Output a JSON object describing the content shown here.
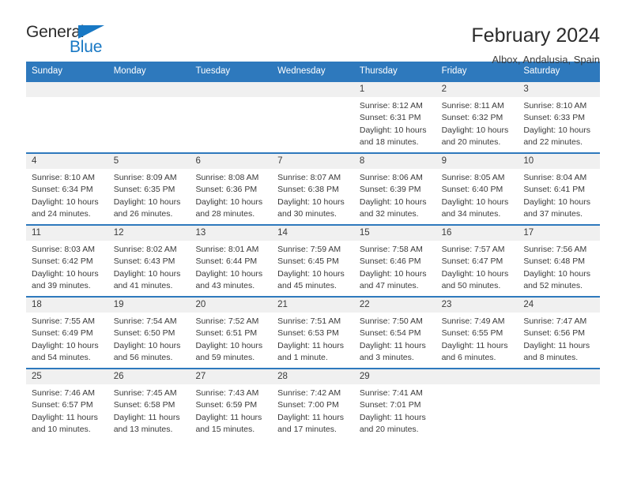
{
  "brand": {
    "name_part1": "General",
    "name_part2": "Blue"
  },
  "header": {
    "title": "February 2024",
    "location": "Albox, Andalusia, Spain"
  },
  "colors": {
    "header_blue": "#2e79bd",
    "daynum_band": "#f0f0f0",
    "brand_blue": "#1878c4",
    "text": "#3a3a3a"
  },
  "calendar": {
    "weekday_headers": [
      "Sunday",
      "Monday",
      "Tuesday",
      "Wednesday",
      "Thursday",
      "Friday",
      "Saturday"
    ],
    "weeks": [
      [
        {
          "day": "",
          "empty": true
        },
        {
          "day": "",
          "empty": true
        },
        {
          "day": "",
          "empty": true
        },
        {
          "day": "",
          "empty": true
        },
        {
          "day": "1",
          "sunrise": "Sunrise: 8:12 AM",
          "sunset": "Sunset: 6:31 PM",
          "daylight_line1": "Daylight: 10 hours",
          "daylight_line2": "and 18 minutes."
        },
        {
          "day": "2",
          "sunrise": "Sunrise: 8:11 AM",
          "sunset": "Sunset: 6:32 PM",
          "daylight_line1": "Daylight: 10 hours",
          "daylight_line2": "and 20 minutes."
        },
        {
          "day": "3",
          "sunrise": "Sunrise: 8:10 AM",
          "sunset": "Sunset: 6:33 PM",
          "daylight_line1": "Daylight: 10 hours",
          "daylight_line2": "and 22 minutes."
        }
      ],
      [
        {
          "day": "4",
          "sunrise": "Sunrise: 8:10 AM",
          "sunset": "Sunset: 6:34 PM",
          "daylight_line1": "Daylight: 10 hours",
          "daylight_line2": "and 24 minutes."
        },
        {
          "day": "5",
          "sunrise": "Sunrise: 8:09 AM",
          "sunset": "Sunset: 6:35 PM",
          "daylight_line1": "Daylight: 10 hours",
          "daylight_line2": "and 26 minutes."
        },
        {
          "day": "6",
          "sunrise": "Sunrise: 8:08 AM",
          "sunset": "Sunset: 6:36 PM",
          "daylight_line1": "Daylight: 10 hours",
          "daylight_line2": "and 28 minutes."
        },
        {
          "day": "7",
          "sunrise": "Sunrise: 8:07 AM",
          "sunset": "Sunset: 6:38 PM",
          "daylight_line1": "Daylight: 10 hours",
          "daylight_line2": "and 30 minutes."
        },
        {
          "day": "8",
          "sunrise": "Sunrise: 8:06 AM",
          "sunset": "Sunset: 6:39 PM",
          "daylight_line1": "Daylight: 10 hours",
          "daylight_line2": "and 32 minutes."
        },
        {
          "day": "9",
          "sunrise": "Sunrise: 8:05 AM",
          "sunset": "Sunset: 6:40 PM",
          "daylight_line1": "Daylight: 10 hours",
          "daylight_line2": "and 34 minutes."
        },
        {
          "day": "10",
          "sunrise": "Sunrise: 8:04 AM",
          "sunset": "Sunset: 6:41 PM",
          "daylight_line1": "Daylight: 10 hours",
          "daylight_line2": "and 37 minutes."
        }
      ],
      [
        {
          "day": "11",
          "sunrise": "Sunrise: 8:03 AM",
          "sunset": "Sunset: 6:42 PM",
          "daylight_line1": "Daylight: 10 hours",
          "daylight_line2": "and 39 minutes."
        },
        {
          "day": "12",
          "sunrise": "Sunrise: 8:02 AM",
          "sunset": "Sunset: 6:43 PM",
          "daylight_line1": "Daylight: 10 hours",
          "daylight_line2": "and 41 minutes."
        },
        {
          "day": "13",
          "sunrise": "Sunrise: 8:01 AM",
          "sunset": "Sunset: 6:44 PM",
          "daylight_line1": "Daylight: 10 hours",
          "daylight_line2": "and 43 minutes."
        },
        {
          "day": "14",
          "sunrise": "Sunrise: 7:59 AM",
          "sunset": "Sunset: 6:45 PM",
          "daylight_line1": "Daylight: 10 hours",
          "daylight_line2": "and 45 minutes."
        },
        {
          "day": "15",
          "sunrise": "Sunrise: 7:58 AM",
          "sunset": "Sunset: 6:46 PM",
          "daylight_line1": "Daylight: 10 hours",
          "daylight_line2": "and 47 minutes."
        },
        {
          "day": "16",
          "sunrise": "Sunrise: 7:57 AM",
          "sunset": "Sunset: 6:47 PM",
          "daylight_line1": "Daylight: 10 hours",
          "daylight_line2": "and 50 minutes."
        },
        {
          "day": "17",
          "sunrise": "Sunrise: 7:56 AM",
          "sunset": "Sunset: 6:48 PM",
          "daylight_line1": "Daylight: 10 hours",
          "daylight_line2": "and 52 minutes."
        }
      ],
      [
        {
          "day": "18",
          "sunrise": "Sunrise: 7:55 AM",
          "sunset": "Sunset: 6:49 PM",
          "daylight_line1": "Daylight: 10 hours",
          "daylight_line2": "and 54 minutes."
        },
        {
          "day": "19",
          "sunrise": "Sunrise: 7:54 AM",
          "sunset": "Sunset: 6:50 PM",
          "daylight_line1": "Daylight: 10 hours",
          "daylight_line2": "and 56 minutes."
        },
        {
          "day": "20",
          "sunrise": "Sunrise: 7:52 AM",
          "sunset": "Sunset: 6:51 PM",
          "daylight_line1": "Daylight: 10 hours",
          "daylight_line2": "and 59 minutes."
        },
        {
          "day": "21",
          "sunrise": "Sunrise: 7:51 AM",
          "sunset": "Sunset: 6:53 PM",
          "daylight_line1": "Daylight: 11 hours",
          "daylight_line2": "and 1 minute."
        },
        {
          "day": "22",
          "sunrise": "Sunrise: 7:50 AM",
          "sunset": "Sunset: 6:54 PM",
          "daylight_line1": "Daylight: 11 hours",
          "daylight_line2": "and 3 minutes."
        },
        {
          "day": "23",
          "sunrise": "Sunrise: 7:49 AM",
          "sunset": "Sunset: 6:55 PM",
          "daylight_line1": "Daylight: 11 hours",
          "daylight_line2": "and 6 minutes."
        },
        {
          "day": "24",
          "sunrise": "Sunrise: 7:47 AM",
          "sunset": "Sunset: 6:56 PM",
          "daylight_line1": "Daylight: 11 hours",
          "daylight_line2": "and 8 minutes."
        }
      ],
      [
        {
          "day": "25",
          "sunrise": "Sunrise: 7:46 AM",
          "sunset": "Sunset: 6:57 PM",
          "daylight_line1": "Daylight: 11 hours",
          "daylight_line2": "and 10 minutes."
        },
        {
          "day": "26",
          "sunrise": "Sunrise: 7:45 AM",
          "sunset": "Sunset: 6:58 PM",
          "daylight_line1": "Daylight: 11 hours",
          "daylight_line2": "and 13 minutes."
        },
        {
          "day": "27",
          "sunrise": "Sunrise: 7:43 AM",
          "sunset": "Sunset: 6:59 PM",
          "daylight_line1": "Daylight: 11 hours",
          "daylight_line2": "and 15 minutes."
        },
        {
          "day": "28",
          "sunrise": "Sunrise: 7:42 AM",
          "sunset": "Sunset: 7:00 PM",
          "daylight_line1": "Daylight: 11 hours",
          "daylight_line2": "and 17 minutes."
        },
        {
          "day": "29",
          "sunrise": "Sunrise: 7:41 AM",
          "sunset": "Sunset: 7:01 PM",
          "daylight_line1": "Daylight: 11 hours",
          "daylight_line2": "and 20 minutes."
        },
        {
          "day": "",
          "empty": true
        },
        {
          "day": "",
          "empty": true
        }
      ]
    ]
  }
}
